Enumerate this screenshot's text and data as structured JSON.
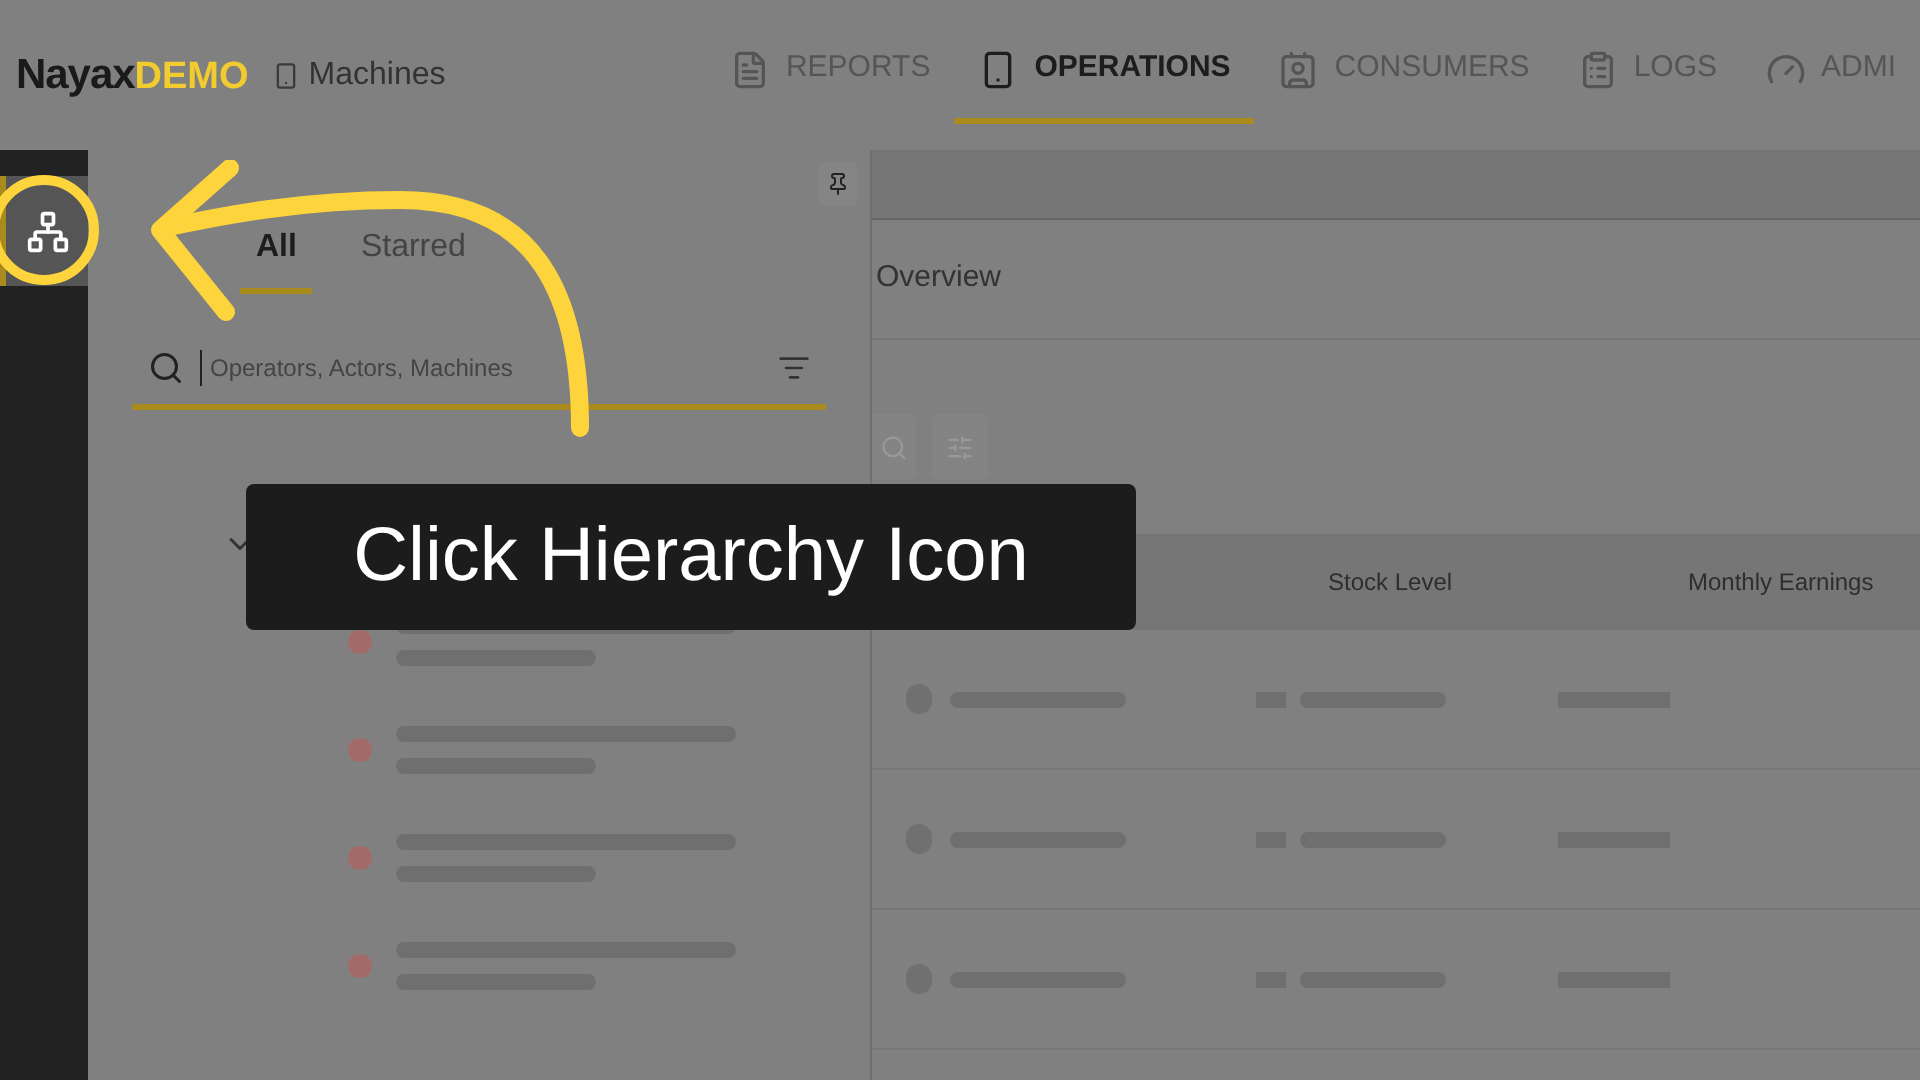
{
  "header": {
    "logo": {
      "name": "Nayax",
      "badge": "DEMO"
    },
    "page_title": "Machines",
    "nav_tabs": [
      {
        "label": "REPORTS",
        "kind": "reports",
        "selected": false
      },
      {
        "label": "OPERATIONS",
        "kind": "operations",
        "selected": true
      },
      {
        "label": "CONSUMERS",
        "kind": "consumers",
        "selected": false
      },
      {
        "label": "LOGS",
        "kind": "logs",
        "selected": false
      },
      {
        "label": "ADMI",
        "kind": "admin",
        "selected": false
      }
    ]
  },
  "sidebar": {
    "items": [
      {
        "kind": "hierarchy",
        "selected": true
      }
    ]
  },
  "tree_panel": {
    "tabs": [
      {
        "label": "All",
        "selected": true
      },
      {
        "label": "Starred",
        "selected": false
      }
    ],
    "search": {
      "placeholder": "Operators, Actors, Machines"
    }
  },
  "main": {
    "section_title": "Overview",
    "table": {
      "columns": [
        "Stock Level",
        "Monthly Earnings"
      ]
    }
  },
  "callout": {
    "text": "Click Hierarchy Icon"
  }
}
